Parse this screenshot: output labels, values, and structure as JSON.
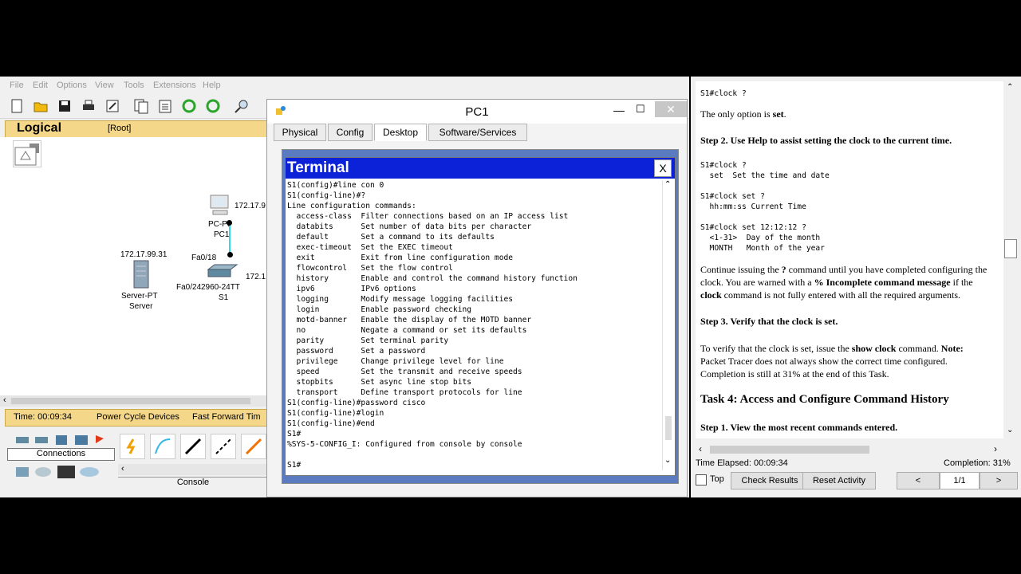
{
  "menu": [
    "File",
    "Edit",
    "Options",
    "View",
    "Tools",
    "Extensions",
    "Help"
  ],
  "workspace": {
    "logical_label": "Logical",
    "root_label": "[Root]",
    "devices": {
      "pc_ip": "172.17.9",
      "pc_port": "PC-Pt",
      "pc_name": "PC1",
      "server_ip": "172.17.99.31",
      "server_type": "Server-PT",
      "server_name": "Server",
      "switch_port_fa018": "Fa0/18",
      "switch_port_fa024": "Fa0/24",
      "switch_model": "2960-24TT",
      "switch_name": "S1",
      "switch_ip": "172.1"
    },
    "time": "Time: 00:09:34",
    "power_cycle": "Power Cycle Devices",
    "fast_forward": "Fast Forward Tim",
    "connections_label": "Connections",
    "console_label": "Console"
  },
  "pc1": {
    "title": "PC1",
    "tabs": [
      "Physical",
      "Config",
      "Desktop",
      "Software/Services"
    ],
    "active_tab": "Desktop",
    "terminal_title": "Terminal",
    "terminal_close": "X",
    "terminal_text": "S1(config)#line con 0\nS1(config-line)#?\nLine configuration commands:\n  access-class  Filter connections based on an IP access list\n  databits      Set number of data bits per character\n  default       Set a command to its defaults\n  exec-timeout  Set the EXEC timeout\n  exit          Exit from line configuration mode\n  flowcontrol   Set the flow control\n  history       Enable and control the command history function\n  ipv6          IPv6 options\n  logging       Modify message logging facilities\n  login         Enable password checking\n  motd-banner   Enable the display of the MOTD banner\n  no            Negate a command or set its defaults\n  parity        Set terminal parity\n  password      Set a password\n  privilege     Change privilege level for line\n  speed         Set the transmit and receive speeds\n  stopbits      Set async line stop bits\n  transport     Define transport protocols for line\nS1(config-line)#password cisco\nS1(config-line)#login\nS1(config-line)#end\nS1#\n%SYS-5-CONFIG_I: Configured from console by console\n\nS1#"
  },
  "instructions": {
    "l1": "S1#clock ?",
    "l2a": "The only option is ",
    "l2b": "set",
    "l2c": ".",
    "step2": "Step 2. Use Help to assist setting the clock to the current time.",
    "c1": "S1#clock ?",
    "c2": "  set  Set the time and date",
    "c3": "S1#clock set ?",
    "c4": "  hh:mm:ss Current Time",
    "c5": "S1#clock set 12:12:12 ?",
    "c6": "  <1-31>  Day of the month",
    "c7": "  MONTH   Month of the year",
    "p1a": "Continue issuing the ",
    "p1b": "?",
    "p1c": " command until you have completed configuring the",
    "p2a": "clock. You are warned with a ",
    "p2b": "% Incomplete command message",
    "p2c": " if the",
    "p3a": "clock",
    "p3b": " command is not fully entered with all the required arguments.",
    "step3": "Step 3. Verify that the clock is set.",
    "v1a": "To verify that the clock is set, issue the ",
    "v1b": "show clock",
    "v1c": " command. ",
    "v1d": "Note:",
    "v2": "Packet Tracer does not always show the correct time configured.",
    "v3": "Completion is still at 31% at the end of this Task.",
    "task4": "Task 4: Access and Configure Command History",
    "step1": "Step 1. View the most recent commands entered.",
    "time_elapsed": "Time Elapsed: 00:09:34",
    "completion": "Completion: 31%",
    "top_label": "Top",
    "check_results": "Check Results",
    "reset_activity": "Reset Activity",
    "prev": "<",
    "page": "1/1",
    "next": ">"
  }
}
